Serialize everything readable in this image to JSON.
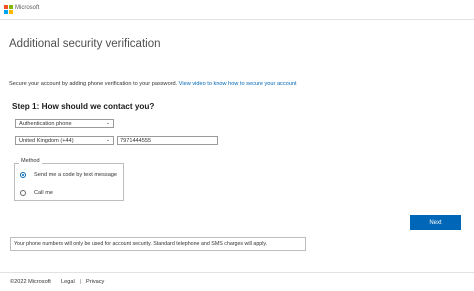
{
  "header": {
    "brand_name": "Microsoft",
    "logo_colors": [
      "#f25022",
      "#7fba00",
      "#00a4ef",
      "#ffb900"
    ]
  },
  "main": {
    "title": "Additional security verification",
    "intro_text": "Secure your account by adding phone verification to your password.",
    "intro_link": "View video to know how to secure your account",
    "step_heading": "Step 1: How should we contact you?",
    "contact_method": {
      "selected": "Authentication phone"
    },
    "country": {
      "selected": "United Kingdom (+44)"
    },
    "phone_number": {
      "value": "7971444555"
    },
    "method": {
      "legend": "Method",
      "options": [
        {
          "label": "Send me a code by text message",
          "checked": true
        },
        {
          "label": "Call me",
          "checked": false
        }
      ]
    },
    "next_label": "Next",
    "notice": "Your phone numbers will only be used for account security. Standard telephone and SMS charges will apply."
  },
  "footer": {
    "copyright": "©2022 Microsoft",
    "legal": "Legal",
    "separator": "|",
    "privacy": "Privacy"
  },
  "colors": {
    "accent": "#0067b8"
  }
}
